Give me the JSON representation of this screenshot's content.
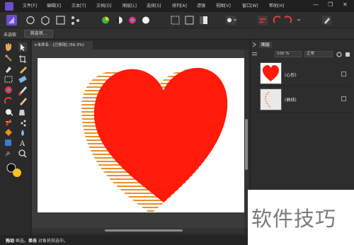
{
  "menubar": {
    "items": [
      "文件[F]",
      "编辑[E]",
      "文本[T]",
      "文档[D]",
      "图层[L]",
      "选择[S]",
      "排列[A]",
      "滤镜",
      "视图[V]",
      "窗口[W]",
      "帮助[H]"
    ]
  },
  "context": {
    "label": "未选取",
    "button": "首选项..."
  },
  "document": {
    "tab_label": "×未命名 - [已修改] (56.3%)"
  },
  "layers_panel": {
    "tab_label": "图层",
    "opacity": "100 %",
    "blend_mode": "正常",
    "layers": [
      {
        "name": "(心形)"
      },
      {
        "name": "(曲线)"
      }
    ]
  },
  "status": {
    "bold1": "拖动",
    "text1": " 框选。",
    "bold2": "单击",
    "text2": " 对象将其选中。"
  },
  "watermark": {
    "text": "软件技巧"
  },
  "colors": {
    "heart_fill": "#ff1a0a",
    "stripe_color": "#e8902a",
    "brand": "#6e4bd1"
  }
}
